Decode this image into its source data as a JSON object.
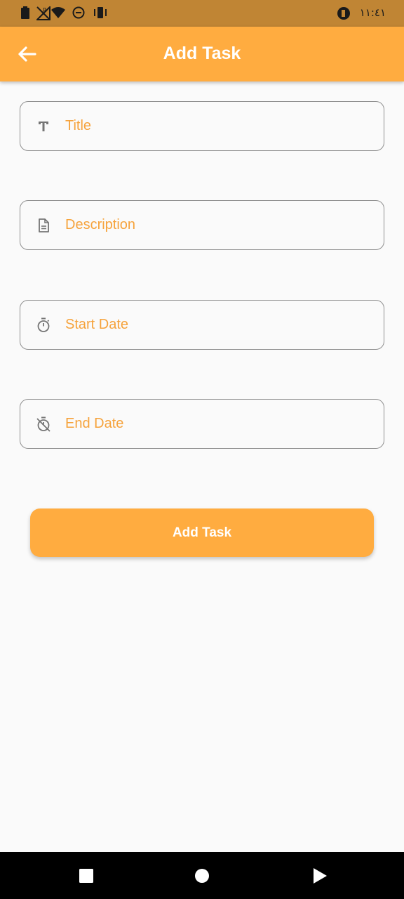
{
  "status_bar": {
    "time": "١١:٤١",
    "icons": [
      "battery-icon",
      "no-signal-icon",
      "wifi-icon",
      "do-not-disturb-icon",
      "vibrate-icon",
      "app-notification-icon"
    ]
  },
  "app_bar": {
    "title": "Add Task",
    "back_icon": "arrow-back-icon"
  },
  "form": {
    "fields": [
      {
        "placeholder": "Title",
        "value": "",
        "icon": "text-title-icon"
      },
      {
        "placeholder": "Description",
        "value": "",
        "icon": "description-icon"
      },
      {
        "placeholder": "Start Date",
        "value": "",
        "icon": "timer-icon"
      },
      {
        "placeholder": "End Date",
        "value": "",
        "icon": "timer-off-icon"
      }
    ],
    "submit_label": "Add Task"
  },
  "nav_bar": {
    "buttons": [
      "recents-square-icon",
      "home-circle-icon",
      "back-triangle-icon"
    ]
  },
  "colors": {
    "accent": "#ffac40",
    "status_bar": "#c08534",
    "placeholder": "#f6a33c",
    "border": "#8f8f8f",
    "background": "#fafafa"
  }
}
